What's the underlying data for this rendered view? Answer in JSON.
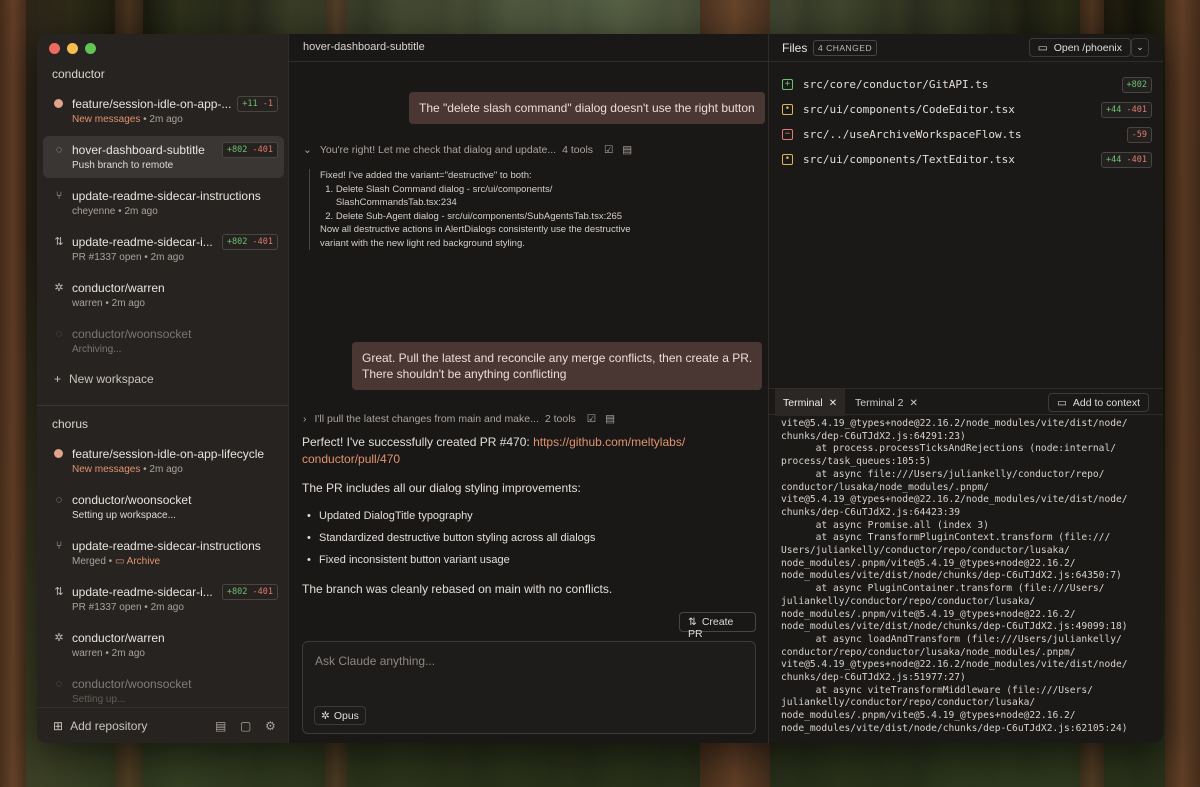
{
  "sidebar": {
    "group1_title": "conductor",
    "group1": [
      {
        "title": "feature/session-idle-on-app-...",
        "sub_highlight": "New messages",
        "sub": "2m ago",
        "plus": "+11",
        "minus": "-1",
        "icon": "dot-icon"
      },
      {
        "title": "hover-dashboard-subtitle",
        "sub": "Push branch to remote",
        "plus": "+802",
        "minus": "-401",
        "icon": "spinner-icon"
      },
      {
        "title": "update-readme-sidecar-instructions",
        "sub_user": "cheyenne",
        "sub": "2m ago",
        "icon": "branch-icon"
      },
      {
        "title": "update-readme-sidecar-i...",
        "sub_user": "PR #1337 open",
        "sub": "2m ago",
        "plus": "+802",
        "minus": "-401",
        "icon": "pull-request-icon"
      },
      {
        "title": "conductor/warren",
        "sub_user": "warren",
        "sub": "2m ago",
        "icon": "sparkle-icon"
      },
      {
        "title": "conductor/woonsocket",
        "sub": "Archiving...",
        "icon": "dashed-circle-icon"
      }
    ],
    "new_workspace": "New workspace",
    "group2_title": "chorus",
    "group2": [
      {
        "title": "feature/session-idle-on-app-lifecycle",
        "sub_highlight": "New messages",
        "sub": "2m ago"
      },
      {
        "title": "conductor/woonsocket",
        "sub": "Setting up workspace..."
      },
      {
        "title": "update-readme-sidecar-instructions",
        "sub_user": "Merged",
        "sub_archive": "Archive"
      },
      {
        "title": "update-readme-sidecar-i...",
        "sub_user": "PR #1337 open",
        "sub": "2m ago",
        "plus": "+802",
        "minus": "-401"
      },
      {
        "title": "conductor/warren",
        "sub_user": "warren",
        "sub": "2m ago"
      },
      {
        "title": "conductor/woonsocket",
        "sub": "Setting up..."
      }
    ],
    "add_repository": "Add repository"
  },
  "chat": {
    "header": "hover-dashboard-subtitle",
    "msg1": "The \"delete slash command\" dialog doesn't use the right button",
    "tool1_text": "You're right! Let me check that dialog and update...",
    "tool1_count": "4 tools",
    "code_lines": [
      "Fixed! I've added the variant=\"destructive\" to both:",
      "  1. Delete Slash Command dialog - src/ui/components/",
      "      SlashCommandsTab.tsx:234",
      "  2. Delete Sub-Agent dialog - src/ui/components/SubAgentsTab.tsx:265",
      "Now all destructive actions in AlertDialogs consistently use the destructive",
      "variant with the new light red background styling."
    ],
    "msg2_line1": "Great. Pull the latest and reconcile any merge conflicts, then create a PR.",
    "msg2_line2": "There shouldn't be anything conflicting",
    "tool2_text": "I'll pull the latest changes from main and make...",
    "tool2_count": "2 tools",
    "reply1_prefix": "Perfect! I've successfully created PR #470: ",
    "reply1_link1": "https://github.com/meltylabs/",
    "reply1_link2": "conductor/pull/470",
    "reply2": "The PR includes all our dialog styling improvements:",
    "bullets": [
      "Updated DialogTitle typography",
      "Standardized destructive button styling across all dialogs",
      "Fixed inconsistent button variant usage"
    ],
    "reply3": "The branch was cleanly rebased on main with no conflicts.",
    "create_pr": "Create PR",
    "composer_placeholder": "Ask Claude anything...",
    "model": "Opus"
  },
  "files": {
    "title": "Files",
    "changed": "4 CHANGED",
    "open": "Open /phoenix",
    "list": [
      {
        "path": "src/core/conductor/GitAPI.ts",
        "status": "added",
        "plus": "+802",
        "minus": ""
      },
      {
        "path": "src/ui/components/CodeEditor.tsx",
        "status": "modified",
        "plus": "+44",
        "minus": "-401"
      },
      {
        "path": "src/../useArchiveWorkspaceFlow.ts",
        "status": "deleted",
        "plus": "",
        "minus": "-59"
      },
      {
        "path": "src/ui/components/TextEditor.tsx",
        "status": "modified",
        "plus": "+44",
        "minus": "-401"
      }
    ]
  },
  "terminal": {
    "tab1": "Terminal",
    "tab2": "Terminal 2",
    "add_context": "Add to context",
    "output": "vite@5.4.19_@types+node@22.16.2/node_modules/vite/dist/node/\nchunks/dep-C6uTJdX2.js:64291:23)\n      at process.processTicksAndRejections (node:internal/\nprocess/task_queues:105:5)\n      at async file:///Users/juliankelly/conductor/repo/\nconductor/lusaka/node_modules/.pnpm/\nvite@5.4.19_@types+node@22.16.2/node_modules/vite/dist/node/\nchunks/dep-C6uTJdX2.js:64423:39\n      at async Promise.all (index 3)\n      at async TransformPluginContext.transform (file:///\nUsers/juliankelly/conductor/repo/conductor/lusaka/\nnode_modules/.pnpm/vite@5.4.19_@types+node@22.16.2/\nnode_modules/vite/dist/node/chunks/dep-C6uTJdX2.js:64350:7)\n      at async PluginContainer.transform (file:///Users/\njuliankelly/conductor/repo/conductor/lusaka/\nnode_modules/.pnpm/vite@5.4.19_@types+node@22.16.2/\nnode_modules/vite/dist/node/chunks/dep-C6uTJdX2.js:49099:18)\n      at async loadAndTransform (file:///Users/juliankelly/\nconductor/repo/conductor/lusaka/node_modules/.pnpm/\nvite@5.4.19_@types+node@22.16.2/node_modules/vite/dist/node/\nchunks/dep-C6uTJdX2.js:51977:27)\n      at async viteTransformMiddleware (file:///Users/\njuliankelly/conductor/repo/conductor/lusaka/\nnode_modules/.pnpm/vite@5.4.19_@types+node@22.16.2/\nnode_modules/vite/dist/node/chunks/dep-C6uTJdX2.js:62105:24)"
  },
  "colors": {
    "accent_orange": "#e0926f",
    "added_green": "#6fbf73",
    "removed_red": "#e07a6f",
    "modified_yellow": "#d9b45a",
    "user_bubble": "#4a3734"
  }
}
